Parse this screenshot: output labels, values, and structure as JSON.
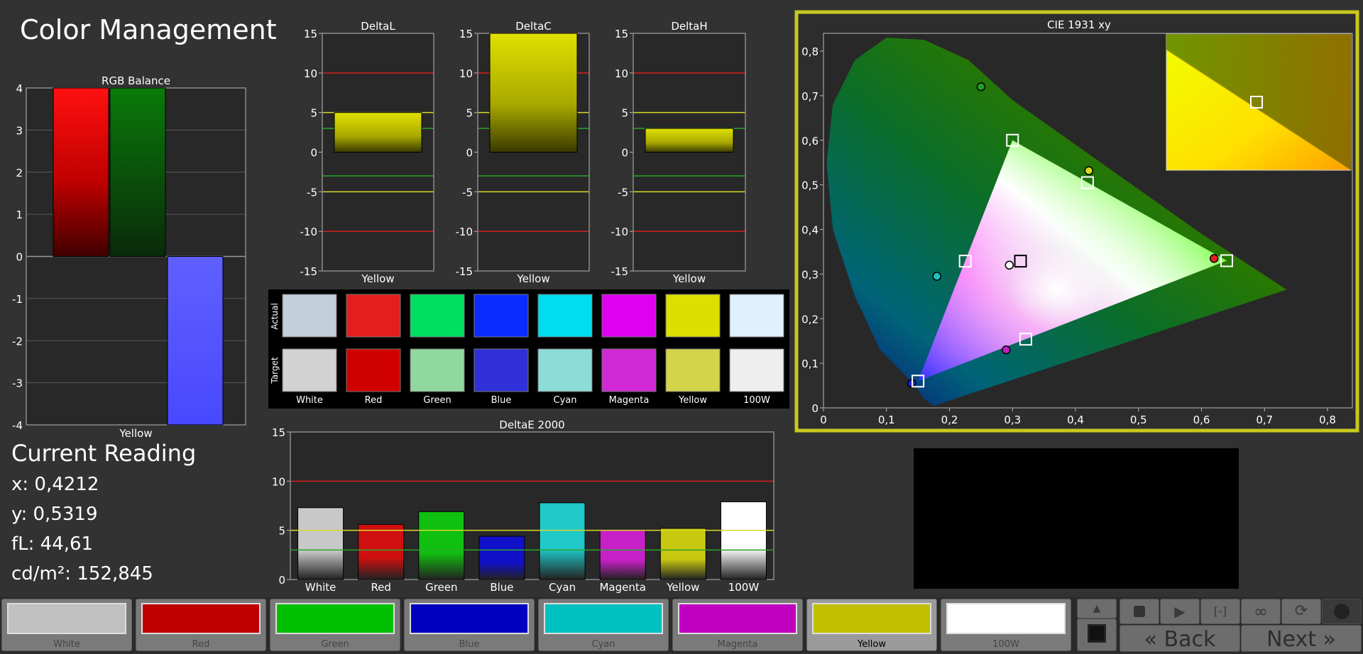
{
  "page_title": "Color Management",
  "current_reading": {
    "title": "Current Reading",
    "x": "x: 0,4212",
    "y": "y: 0,5319",
    "fl": "fL: 44,61",
    "cdm2": "cd/m²: 152,845"
  },
  "colors": {
    "background": "#323232",
    "plot_bg": "#282828",
    "frame_highlight": "#c8c81e",
    "red_line": "#d42020",
    "yellow_line": "#d9d92a",
    "green_line": "#2aa52a"
  },
  "chart_data": [
    {
      "type": "bar",
      "title": "RGB Balance",
      "categories": [
        "Yellow"
      ],
      "series": [
        {
          "color": "#e00000",
          "values": [
            4
          ]
        },
        {
          "color": "#0a6a0a",
          "values": [
            4
          ]
        },
        {
          "color": "#5a5aff",
          "values": [
            -4
          ]
        }
      ],
      "ylim": [
        -4,
        4
      ],
      "yticks": [
        "4",
        "3",
        "2",
        "1",
        "0",
        "-1",
        "-2",
        "-3",
        "-4"
      ],
      "xlabel": "Yellow"
    },
    {
      "type": "bar",
      "title": "DeltaL",
      "categories": [
        "Yellow"
      ],
      "values": [
        5
      ],
      "ylim": [
        -15,
        15
      ],
      "yticks": [
        "15",
        "10",
        "5",
        "0",
        "-5",
        "-10",
        "-15"
      ],
      "xlabel": "Yellow"
    },
    {
      "type": "bar",
      "title": "DeltaC",
      "categories": [
        "Yellow"
      ],
      "values": [
        15
      ],
      "ylim": [
        -15,
        15
      ],
      "yticks": [
        "15",
        "10",
        "5",
        "0",
        "-5",
        "-10",
        "-15"
      ],
      "xlabel": "Yellow"
    },
    {
      "type": "bar",
      "title": "DeltaH",
      "categories": [
        "Yellow"
      ],
      "values": [
        3
      ],
      "ylim": [
        -15,
        15
      ],
      "yticks": [
        "15",
        "10",
        "5",
        "0",
        "-5",
        "-10",
        "-15"
      ],
      "xlabel": "Yellow"
    },
    {
      "type": "bar",
      "title": "DeltaE 2000",
      "categories": [
        "White",
        "Red",
        "Green",
        "Blue",
        "Cyan",
        "Magenta",
        "Yellow",
        "100W"
      ],
      "values": [
        7.3,
        5.6,
        6.9,
        4.4,
        7.8,
        5.0,
        5.2,
        7.9
      ],
      "colors": [
        "#c8c8c8",
        "#d01010",
        "#10c010",
        "#1010c8",
        "#20c8c8",
        "#c820c8",
        "#c8c810",
        "#ffffff"
      ],
      "ylim": [
        0,
        15
      ],
      "yticks": [
        "15",
        "10",
        "5",
        "0"
      ]
    },
    {
      "type": "scatter",
      "title": "CIE 1931 xy",
      "xlim": [
        0,
        0.8
      ],
      "ylim": [
        0,
        0.8
      ],
      "xticks": [
        "0",
        "0,1",
        "0,2",
        "0,3",
        "0,4",
        "0,5",
        "0,6",
        "0,7",
        "0,8"
      ],
      "yticks": [
        "0",
        "0,1",
        "0,2",
        "0,3",
        "0,4",
        "0,5",
        "0,6",
        "0,7",
        "0,8"
      ],
      "targets": [
        {
          "x": 0.64,
          "y": 0.33
        },
        {
          "x": 0.3,
          "y": 0.6
        },
        {
          "x": 0.15,
          "y": 0.06
        },
        {
          "x": 0.225,
          "y": 0.329
        },
        {
          "x": 0.321,
          "y": 0.154
        },
        {
          "x": 0.419,
          "y": 0.505
        },
        {
          "x": 0.3127,
          "y": 0.329
        }
      ],
      "measured": [
        {
          "x": 0.62,
          "y": 0.335,
          "color": "#e02020"
        },
        {
          "x": 0.25,
          "y": 0.72,
          "color": "#20a020"
        },
        {
          "x": 0.14,
          "y": 0.055,
          "color": "#2020e0"
        },
        {
          "x": 0.18,
          "y": 0.295,
          "color": "#20c0c0"
        },
        {
          "x": 0.29,
          "y": 0.13,
          "color": "#c020c0"
        },
        {
          "x": 0.4212,
          "y": 0.5319,
          "color": "#d8d820"
        },
        {
          "x": 0.295,
          "y": 0.32,
          "color": "#ffffff"
        }
      ]
    }
  ],
  "swatch_grid": {
    "row_labels": [
      "Actual",
      "Target"
    ],
    "columns": [
      {
        "label": "White",
        "actual": "#c4cfdc",
        "target": "#d2d2d2"
      },
      {
        "label": "Red",
        "actual": "#e41e1e",
        "target": "#d00000"
      },
      {
        "label": "Green",
        "actual": "#00e060",
        "target": "#90d8a0"
      },
      {
        "label": "Blue",
        "actual": "#0a2cff",
        "target": "#3030d8"
      },
      {
        "label": "Cyan",
        "actual": "#00dcf0",
        "target": "#8cdcd8"
      },
      {
        "label": "Magenta",
        "actual": "#e000f0",
        "target": "#d028d4"
      },
      {
        "label": "Yellow",
        "actual": "#dce000",
        "target": "#d4d44a"
      },
      {
        "label": "100W",
        "actual": "#e0f0ff",
        "target": "#eeeeee"
      }
    ]
  },
  "bottom_swatches": [
    {
      "label": "White",
      "color": "#c0c0c0",
      "active": false
    },
    {
      "label": "Red",
      "color": "#c00000",
      "active": false
    },
    {
      "label": "Green",
      "color": "#00c000",
      "active": false
    },
    {
      "label": "Blue",
      "color": "#0000c0",
      "active": false
    },
    {
      "label": "Cyan",
      "color": "#00c0c0",
      "active": false
    },
    {
      "label": "Magenta",
      "color": "#c000c0",
      "active": false
    },
    {
      "label": "Yellow",
      "color": "#c0c000",
      "active": true
    },
    {
      "label": "100W",
      "color": "#ffffff",
      "active": false
    }
  ],
  "controls": {
    "back_label": "Back",
    "next_label": "Next",
    "icons": [
      "up-arrow-icon",
      "stop-icon",
      "play-icon",
      "measure-once-icon",
      "loop-icon",
      "refresh-icon",
      "record-icon",
      "minimize-icon"
    ]
  }
}
